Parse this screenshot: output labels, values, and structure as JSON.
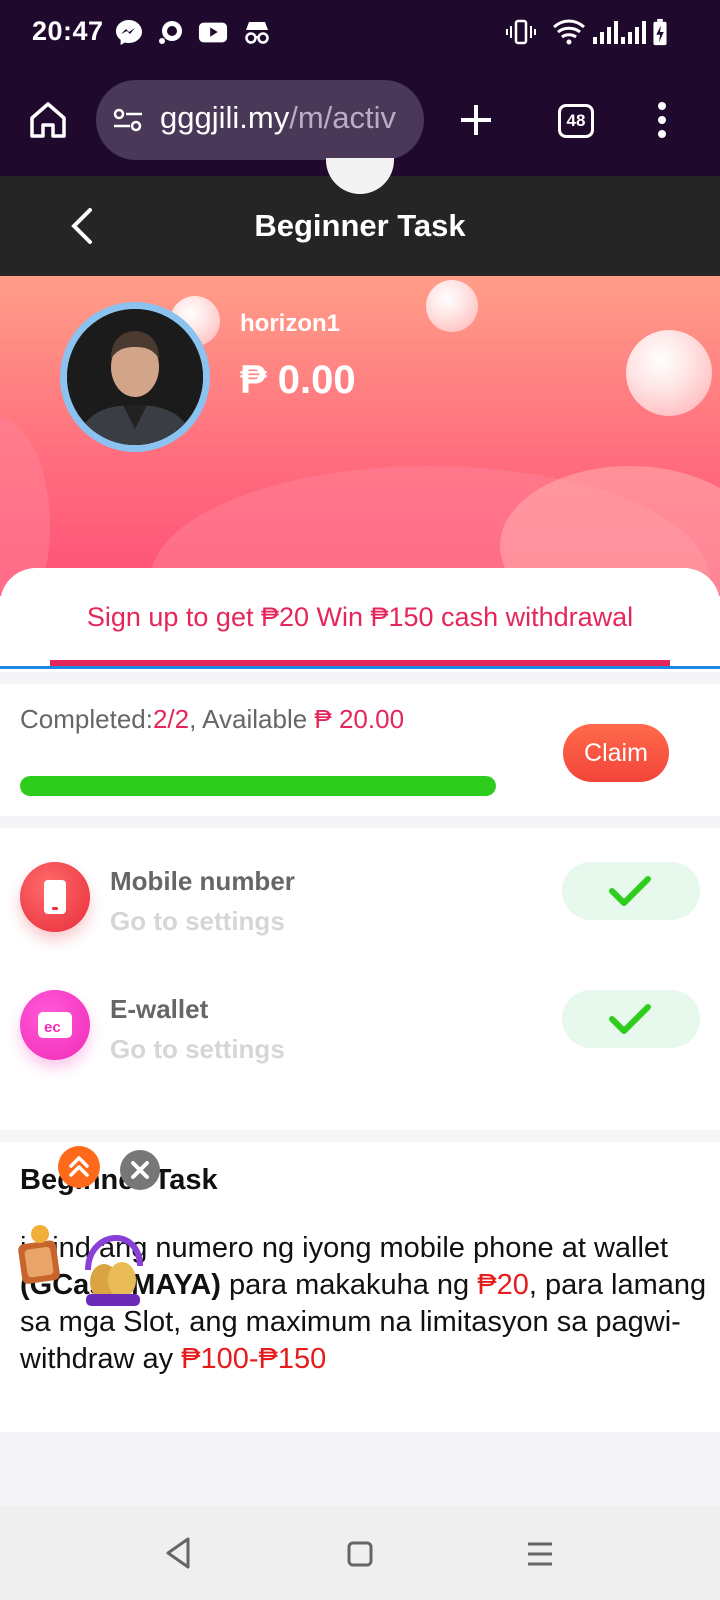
{
  "status_bar": {
    "time": "20:47",
    "left_icons": [
      "messenger-icon",
      "chat-icon",
      "youtube-icon",
      "incognito-icon"
    ],
    "right_icons": [
      "vibrate-icon",
      "wifi-icon",
      "signal-icon",
      "signal-icon",
      "battery-charging-icon"
    ]
  },
  "browser": {
    "url_host": "gggjili.my",
    "url_path": "/m/activ",
    "tab_count": "48"
  },
  "header": {
    "title": "Beginner Task"
  },
  "profile": {
    "username": "horizon1",
    "balance": "₱ 0.00"
  },
  "tab": {
    "label": "Sign up to get ₱20 Win ₱150 cash withdrawal"
  },
  "progress": {
    "completed_label": "Completed:",
    "completed_value": "2/2",
    "available_label": ", Available ",
    "available_value": "₱ 20.00",
    "claim_label": "Claim",
    "fill_fraction": 1.0
  },
  "tasks": [
    {
      "name": "Mobile number",
      "sub": "Go to settings",
      "done": true
    },
    {
      "name": "E-wallet",
      "sub": "Go to settings",
      "done": true
    }
  ],
  "description": {
    "title": "Beginner Task",
    "p1": "i-bind ang numero ng iyong mobile phone at wallet ",
    "bold": "(GCash/MAYA)",
    "p2": " para makakuha ng ",
    "m1": "₱20",
    "p3": ", para lamang sa mga Slot, ang maximum na limitasyon sa pagwi-withdraw ay ",
    "m2": "₱100-₱150"
  },
  "colors": {
    "accent": "#e5265a",
    "claim": "#f2443a",
    "progress": "#2ecc1c",
    "browser_bg": "#1f0a2e"
  }
}
